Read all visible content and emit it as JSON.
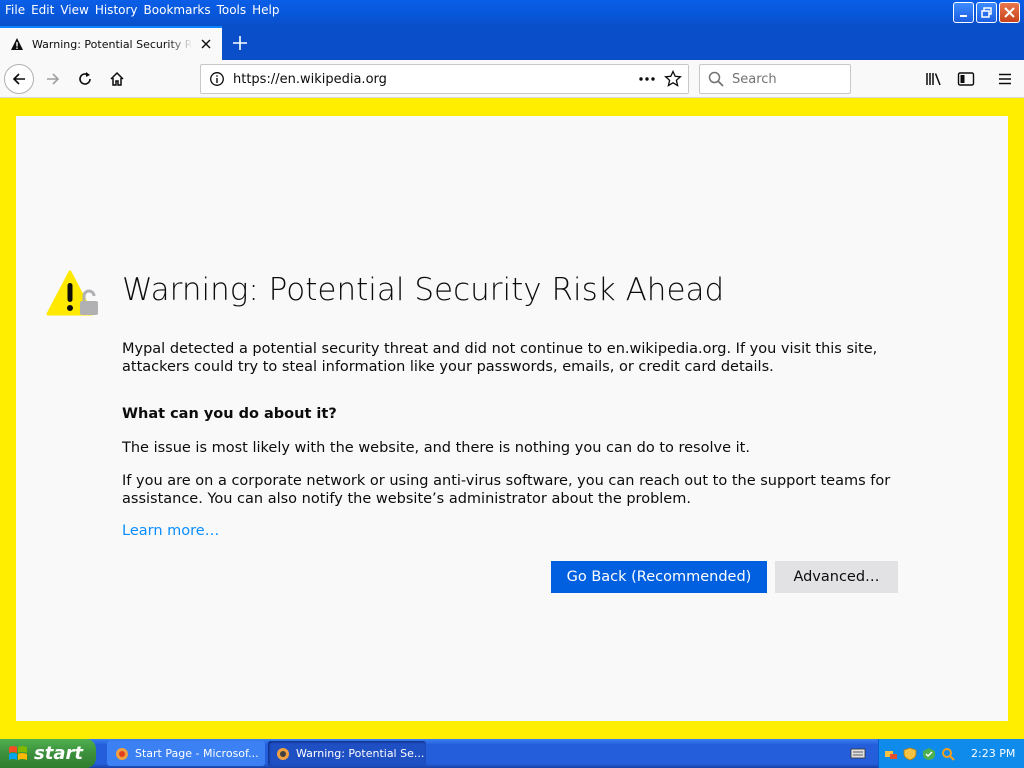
{
  "menubar": {
    "items": [
      "File",
      "Edit",
      "View",
      "History",
      "Bookmarks",
      "Tools",
      "Help"
    ]
  },
  "tab": {
    "title": "Warning: Potential Security Risk Ahead"
  },
  "navbar": {
    "url": "https://en.wikipedia.org",
    "search_placeholder": "Search"
  },
  "error_page": {
    "title": "Warning: Potential Security Risk Ahead",
    "description": "Mypal detected a potential security threat and did not continue to en.wikipedia.org. If you visit this site, attackers could try to steal information like your passwords, emails, or credit card details.",
    "subheading": "What can you do about it?",
    "paragraph1": "The issue is most likely with the website, and there is nothing you can do to resolve it.",
    "paragraph2": "If you are on a corporate network or using anti-virus software, you can reach out to the support teams for assistance. You can also notify the website’s administrator about the problem.",
    "learn_more": "Learn more…",
    "go_back_label": "Go Back (Recommended)",
    "advanced_label": "Advanced…"
  },
  "taskbar": {
    "start_label": "start",
    "tasks": [
      "Start Page - Microsof...",
      "Warning: Potential Se..."
    ],
    "clock": "2:23 PM"
  },
  "colors": {
    "highlight_border": "#ffee00",
    "primary_button": "#0060df",
    "link": "#0a8dff"
  }
}
